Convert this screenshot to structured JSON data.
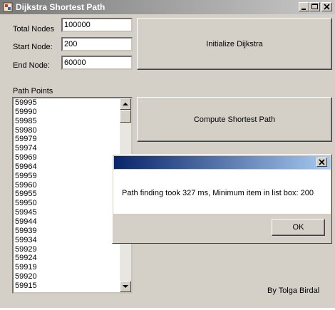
{
  "window": {
    "title": "Dijkstra Shortest Path",
    "caption_buttons": [
      "minimize-icon",
      "maximize-icon",
      "close-icon"
    ]
  },
  "form": {
    "total_nodes_label": "Total Nodes",
    "total_nodes_value": "100000",
    "start_node_label": "Start Node:",
    "start_node_value": "200",
    "end_node_label": "End Node:",
    "end_node_value": "60000",
    "initialize_button": "Initialize Dijkstra",
    "path_points_label": "Path Points",
    "compute_button": "Compute Shortest Path",
    "credit": "By Tolga Birdal"
  },
  "path_points": [
    "59995",
    "59990",
    "59985",
    "59980",
    "59979",
    "59974",
    "59969",
    "59964",
    "59959",
    "59960",
    "59955",
    "59950",
    "59945",
    "59944",
    "59939",
    "59934",
    "59929",
    "59924",
    "59919",
    "59920",
    "59915"
  ],
  "dialog": {
    "message": "Path finding took 327 ms, Minimum item in list box: 200",
    "ok_button": "OK"
  },
  "colors": {
    "window_bg": "#d4d0c8",
    "inactive_title_start": "#7a7a7a",
    "inactive_title_end": "#c8c8c8",
    "active_title_start": "#0a246a",
    "active_title_end": "#a6caf0"
  }
}
